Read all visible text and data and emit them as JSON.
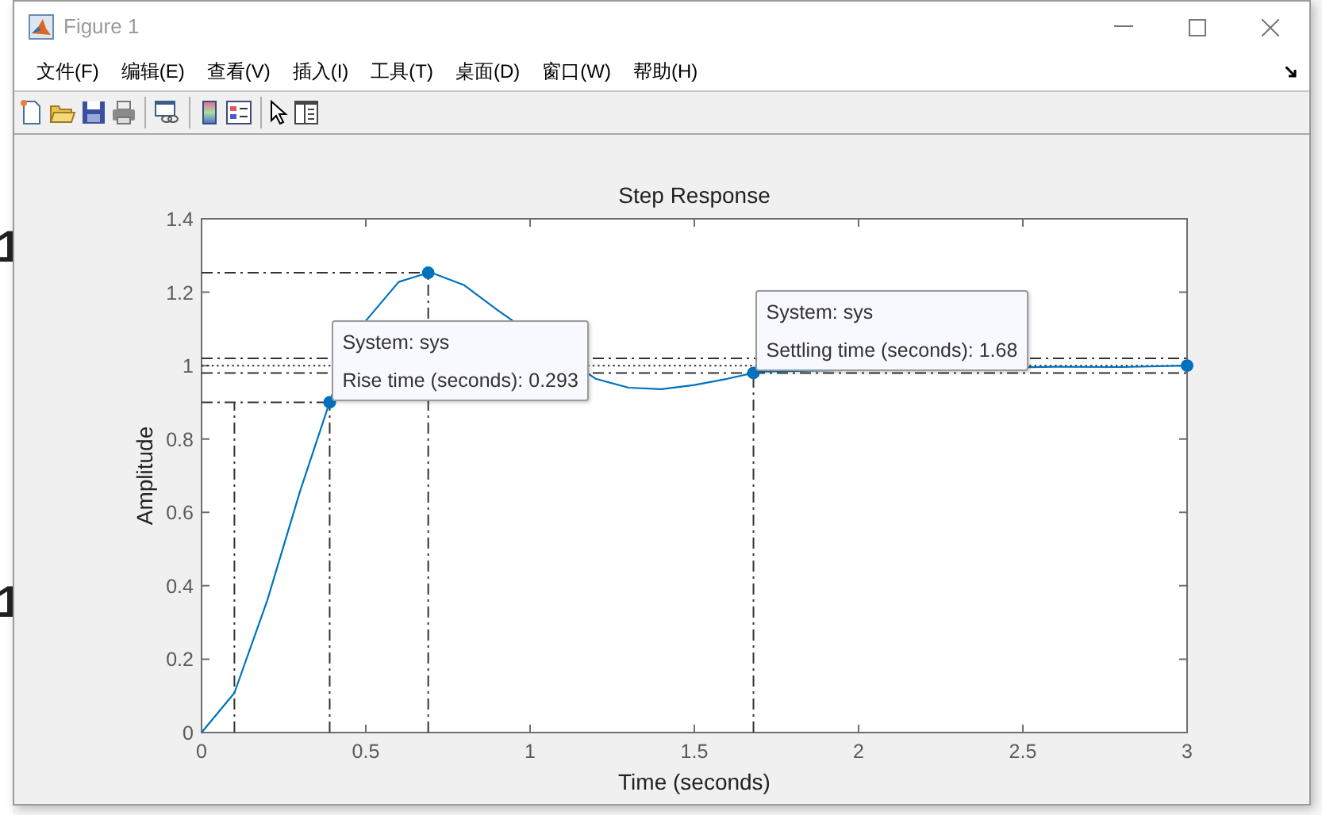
{
  "background": {
    "headings": [
      "1",
      "1"
    ]
  },
  "window": {
    "title": "Figure 1"
  },
  "menu": [
    "文件(F)",
    "编辑(E)",
    "查看(V)",
    "插入(I)",
    "工具(T)",
    "桌面(D)",
    "窗口(W)",
    "帮助(H)"
  ],
  "figure": {
    "chart_data": {
      "type": "line",
      "title": "Step Response",
      "xlabel": "Time (seconds)",
      "ylabel": "Amplitude",
      "x": [
        0,
        0.1,
        0.2,
        0.3,
        0.39,
        0.4,
        0.5,
        0.6,
        0.69,
        0.7,
        0.8,
        0.9,
        1.2,
        1.3,
        1.4,
        1.5,
        1.6,
        1.68,
        1.7,
        2.6,
        2.8,
        3.0
      ],
      "series": [
        {
          "color": "#0072bd",
          "values": [
            0,
            0.108,
            0.36,
            0.658,
            0.9,
            0.927,
            1.122,
            1.228,
            1.253,
            1.253,
            1.219,
            1.152,
            0.964,
            0.94,
            0.936,
            0.947,
            0.964,
            0.98,
            0.984,
            0.997,
            0.996,
            1.0
          ]
        }
      ],
      "xlim": [
        0,
        3
      ],
      "ylim": [
        0,
        1.4
      ],
      "xticks": [
        0,
        0.5,
        1,
        1.5,
        2,
        2.5,
        3
      ],
      "yticks": [
        0,
        0.2,
        0.4,
        0.6,
        0.8,
        1,
        1.2,
        1.4
      ],
      "ref_lines": [
        {
          "axis": "x",
          "value": 0.1
        },
        {
          "axis": "x",
          "value": 0.39
        },
        {
          "axis": "x",
          "value": 0.69
        },
        {
          "axis": "x",
          "value": 1.68
        },
        {
          "axis": "y",
          "value": 0.9
        },
        {
          "axis": "y",
          "value": 1.253
        },
        {
          "axis": "y",
          "value": 1.02
        },
        {
          "axis": "y",
          "value": 0.98
        },
        {
          "axis": "y",
          "value": 1.0
        }
      ],
      "annotations": [
        {
          "text": "System: sys\nRise time (seconds): 0.293"
        },
        {
          "text": "System: sys\nSettling time (seconds): 1.68"
        }
      ]
    }
  }
}
